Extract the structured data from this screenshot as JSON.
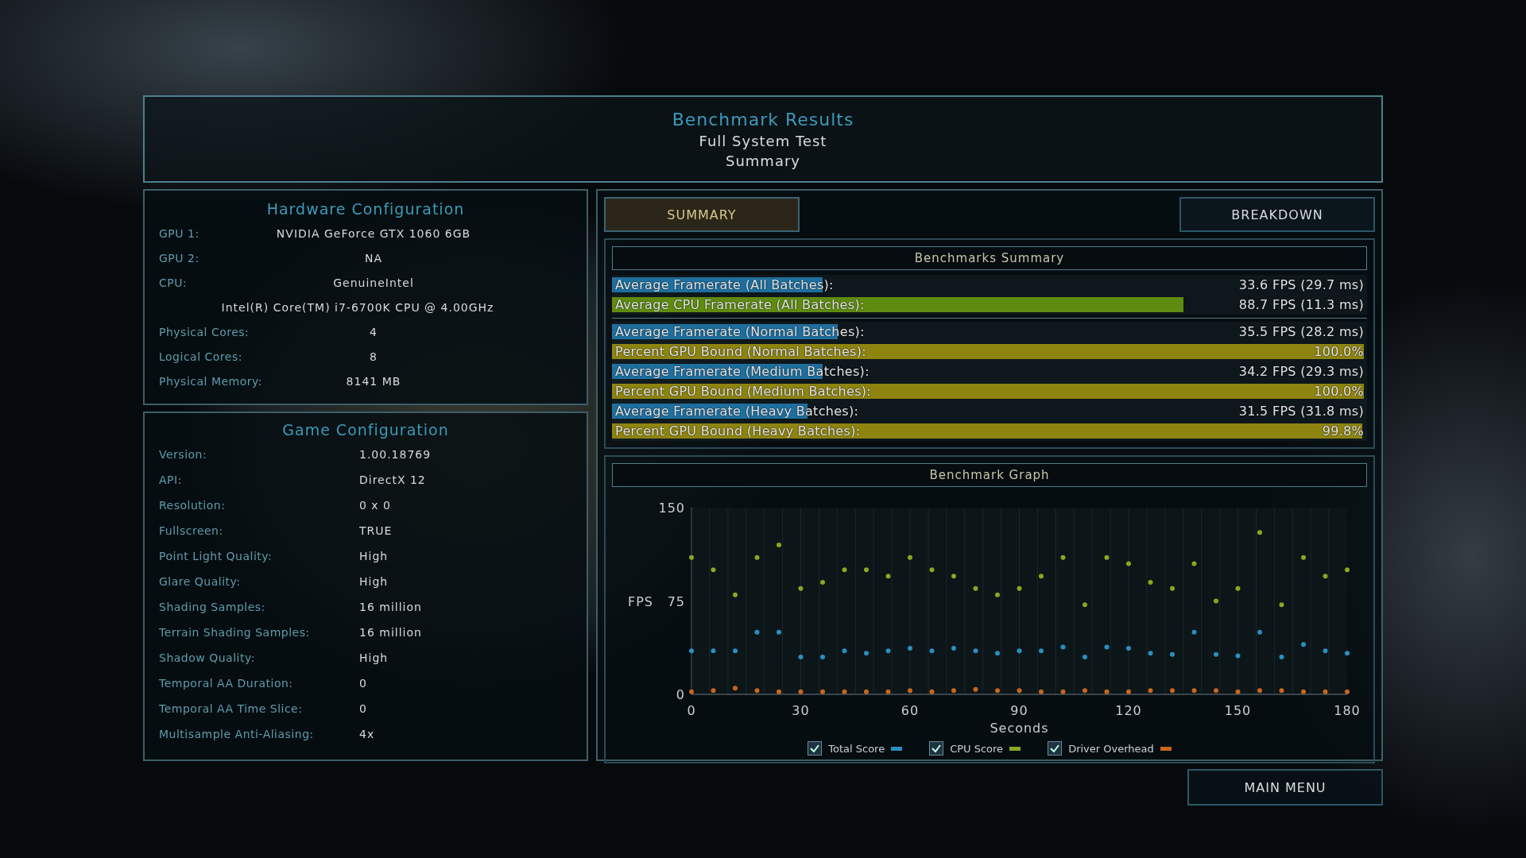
{
  "header": {
    "title": "Benchmark Results",
    "subtitle": "Full System Test",
    "page": "Summary"
  },
  "hardware": {
    "title": "Hardware Configuration",
    "rows": [
      {
        "label": "GPU 1:",
        "value": "NVIDIA GeForce GTX 1060 6GB"
      },
      {
        "label": "GPU 2:",
        "value": "NA"
      },
      {
        "label": "CPU:",
        "value": "GenuineIntel"
      },
      {
        "value": "Intel(R) Core(TM) i7-6700K CPU @ 4.00GHz"
      },
      {
        "label": "Physical Cores:",
        "value": "4"
      },
      {
        "label": "Logical Cores:",
        "value": "8"
      },
      {
        "label": "Physical Memory:",
        "value": "8141  MB"
      }
    ]
  },
  "game": {
    "title": "Game Configuration",
    "rows": [
      {
        "label": "Version:",
        "value": "1.00.18769"
      },
      {
        "label": "API:",
        "value": "DirectX 12"
      },
      {
        "label": "Resolution:",
        "value": "0 x 0"
      },
      {
        "label": "Fullscreen:",
        "value": "TRUE"
      },
      {
        "label": "Point Light Quality:",
        "value": "High"
      },
      {
        "label": "Glare Quality:",
        "value": "High"
      },
      {
        "label": "Shading Samples:",
        "value": "16 million"
      },
      {
        "label": "Terrain Shading Samples:",
        "value": "16 million"
      },
      {
        "label": "Shadow Quality:",
        "value": "High"
      },
      {
        "label": "Temporal AA Duration:",
        "value": "0"
      },
      {
        "label": "Temporal AA Time Slice:",
        "value": "0"
      },
      {
        "label": "Multisample Anti-Aliasing:",
        "value": "4x"
      }
    ]
  },
  "tabs": [
    {
      "label": "SUMMARY",
      "selected": true
    },
    {
      "label": "BREAKDOWN",
      "selected": false
    }
  ],
  "summary": {
    "title": "Benchmarks Summary",
    "groups": [
      {
        "rows": [
          {
            "kind": "framerate",
            "label": "Average Framerate (All Batches):",
            "value": "33.6 FPS (29.7 ms)",
            "level": 0.28
          },
          {
            "kind": "cpu",
            "label": "Average CPU Framerate (All Batches):",
            "value": "88.7 FPS (11.3 ms)",
            "level": 0.76
          }
        ]
      },
      {
        "rows": [
          {
            "kind": "framerate",
            "label": "Average Framerate (Normal Batches):",
            "value": "35.5 FPS (28.2 ms)",
            "level": 0.3
          },
          {
            "kind": "gpu_bound",
            "label": "Percent GPU Bound (Normal Batches):",
            "value": "100.0%",
            "level": 1
          },
          {
            "kind": "framerate",
            "label": "Average Framerate (Medium Batches):",
            "value": "34.2 FPS (29.3 ms)",
            "level": 0.28
          },
          {
            "kind": "gpu_bound",
            "label": "Percent GPU Bound (Medium Batches):",
            "value": "100.0%",
            "level": 1
          },
          {
            "kind": "framerate",
            "label": "Average Framerate (Heavy Batches):",
            "value": "31.5 FPS (31.8 ms)",
            "level": 0.26
          },
          {
            "kind": "gpu_bound",
            "label": "Percent GPU Bound (Heavy Batches):",
            "value": "99.8%",
            "level": 0.998
          }
        ]
      }
    ]
  },
  "graph": {
    "title": "Benchmark Graph",
    "chart_data": {
      "type": "scatter",
      "xlabel": "Seconds",
      "ylabel": "FPS",
      "x": [
        0,
        6,
        12,
        18,
        24,
        30,
        36,
        42,
        48,
        54,
        60,
        66,
        72,
        78,
        84,
        90,
        96,
        102,
        108,
        114,
        120,
        126,
        132,
        138,
        144,
        150,
        156,
        162,
        168,
        174,
        180
      ],
      "grid": true,
      "xlim": [
        0,
        180
      ],
      "ylim": [
        0,
        150
      ],
      "xticks": [
        0,
        30,
        60,
        90,
        120,
        150,
        180
      ],
      "yticks": [
        0,
        75,
        150
      ],
      "series": [
        {
          "name": "Total Score",
          "color": "#2a8fc0",
          "values": [
            35,
            35,
            35,
            50,
            50,
            30,
            30,
            35,
            33,
            35,
            37,
            35,
            37,
            35,
            33,
            35,
            35,
            38,
            30,
            38,
            37,
            33,
            32,
            50,
            32,
            31,
            50,
            30,
            40,
            35,
            33
          ]
        },
        {
          "name": "CPU Score",
          "color": "#8aa822",
          "values": [
            110,
            100,
            80,
            110,
            120,
            85,
            90,
            100,
            100,
            95,
            110,
            100,
            95,
            85,
            80,
            85,
            95,
            110,
            72,
            110,
            105,
            90,
            85,
            105,
            75,
            85,
            130,
            72,
            110,
            95,
            100
          ]
        },
        {
          "name": "Driver Overhead",
          "color": "#c8661e",
          "values": [
            2,
            3,
            5,
            3,
            2,
            2,
            2,
            2,
            2,
            2,
            3,
            2,
            3,
            4,
            3,
            3,
            2,
            2,
            3,
            2,
            2,
            3,
            3,
            3,
            3,
            2,
            3,
            3,
            2,
            2,
            2
          ]
        }
      ]
    },
    "legend": [
      {
        "checked": true
      },
      {
        "checked": true
      },
      {
        "checked": true
      }
    ]
  },
  "main_menu": "MAIN MENU"
}
